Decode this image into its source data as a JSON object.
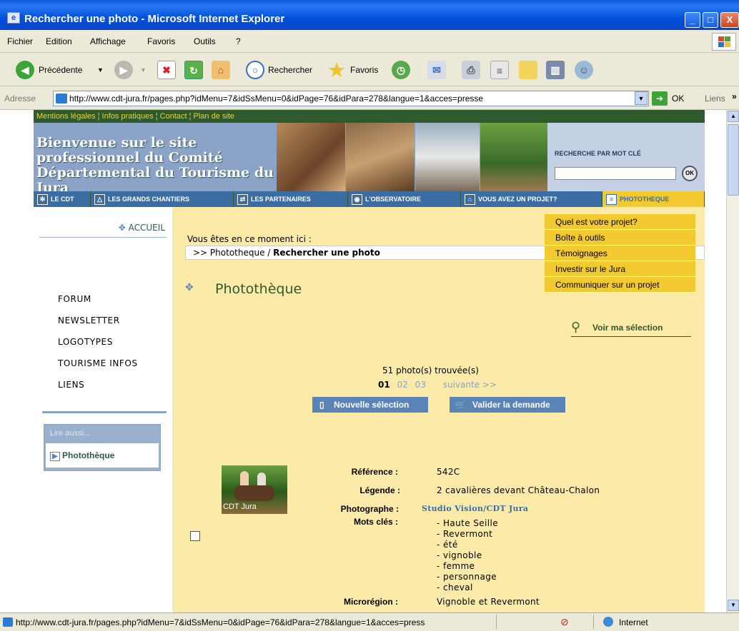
{
  "window": {
    "title": "Rechercher une photo - Microsoft Internet Explorer",
    "icon": "ie-page-icon",
    "controls": [
      "_",
      "□",
      "X"
    ]
  },
  "menu": {
    "items": [
      "Fichier",
      "Edition",
      "Affichage",
      "Favoris",
      "Outils",
      "?"
    ]
  },
  "toolbar": {
    "back_label": "Précédente",
    "search_label": "Rechercher",
    "favorites_label": "Favoris"
  },
  "address": {
    "label": "Adresse",
    "url": "http://www.cdt-jura.fr/pages.php?idMenu=7&idSsMenu=0&idPage=76&idPara=278&langue=1&acces=presse",
    "go_label": "OK",
    "links_label": "Liens"
  },
  "site": {
    "top_links": "Mentions légales ¦ Infos pratiques ¦ Contact ¦ Plan de site",
    "banner_title": "Bienvenue sur le site professionnel du Comité Départemental du Tourisme du Jura",
    "search_title": "RECHERCHE PAR MOT CLÉ",
    "search_button": "OK",
    "nav": [
      "LE CDT",
      "LES GRANDS CHANTIERS",
      "LES PARTENAIRES",
      "L'OBSERVATOIRE",
      "VOUS AVEZ UN PROJET?",
      "PHOTOTHEQUE"
    ],
    "dropdown": [
      "Quel est votre projet?",
      "Boîte à outils",
      "Témoignages",
      "Investir sur le Jura",
      "Communiquer sur un projet"
    ],
    "sidebar": {
      "home": "ACCUEIL",
      "links": [
        "FORUM",
        "NEWSLETTER",
        "LOGOTYPES",
        "TOURISME INFOS",
        "LIENS"
      ],
      "see_also_title": "Lire aussi...",
      "see_also_link": "Photothèque"
    },
    "breadcrumb": {
      "intro": "Vous êtes en ce moment ici :",
      "parent": ">> Phototheque /",
      "current": "Rechercher une photo"
    },
    "page_title": "Photothèque",
    "view_selection": "Voir ma sélection",
    "results_count": "51 photo(s) trouvée(s)",
    "pagination": {
      "current": "01",
      "pages": [
        "02",
        "03"
      ],
      "next": "suivante >>"
    },
    "buttons": {
      "new_selection": "Nouvelle sélection",
      "validate": "Valider la demande"
    },
    "photo": {
      "thumb_caption": "CDT Jura",
      "reference_label": "Référence :",
      "reference": "542C",
      "caption_label": "Légende :",
      "caption": "2 cavalières devant Château-Chalon",
      "photographer_label": "Photographe :",
      "photographer": "Studio Vision/CDT Jura",
      "keywords_label": "Mots clés :",
      "keywords": [
        "- Haute Seille",
        "- Revermont",
        "- été",
        "- vignoble",
        "- femme",
        "- personnage",
        "- cheval"
      ],
      "microregion_label": "Microrégion :",
      "microregion": "Vignoble et Revermont"
    }
  },
  "status": {
    "url": "http://www.cdt-jura.fr/pages.php?idMenu=7&idSsMenu=0&idPage=76&idPara=278&langue=1&acces=press",
    "zone": "Internet"
  },
  "colors": {
    "titlebar": "#0a5ce0",
    "site_green": "#2e5a2e",
    "nav_blue": "#3b6da3",
    "main_bg": "#fbeaa8",
    "dropdown": "#f2c92e",
    "accent_blue": "#5a83b8"
  }
}
